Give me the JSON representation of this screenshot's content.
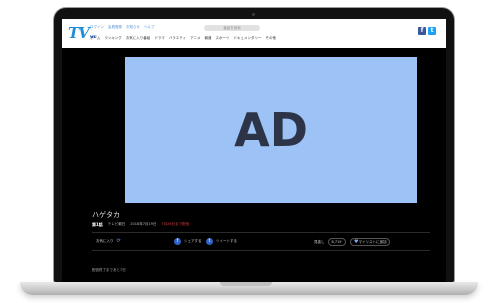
{
  "site": {
    "logo": "TV",
    "logo_sub": "ver",
    "top_links": [
      "ログイン",
      "会員登録",
      "お知らせ",
      "ヘルプ"
    ],
    "search_placeholder": "番組を検索",
    "nav": [
      "ホーム",
      "ランキング",
      "お気に入り番組",
      "ドラマ",
      "バラエティ",
      "アニメ",
      "報道",
      "スポーツ",
      "ドキュメンタリー",
      "その他"
    ],
    "social": {
      "facebook": "f",
      "twitter": "t"
    }
  },
  "player": {
    "ad_label": "AD"
  },
  "program": {
    "title": "ハゲタカ",
    "episode": "第1話",
    "channel": "テレビ朝日",
    "air_date": "2018年7月19日",
    "deadline": "7月26日まで配信",
    "share_label": "お気に入り",
    "fb_label": "シェアする",
    "tw_label": "ツイートする",
    "count_label": "見逃し",
    "count_value": "8,719",
    "reminder_label": "マイリストに追加"
  },
  "footnote": "配信終了まであと7日",
  "colors": {
    "ad_bg": "#9cc2f6",
    "accent": "#2f62c6",
    "deadline_red": "#e23b3b"
  }
}
